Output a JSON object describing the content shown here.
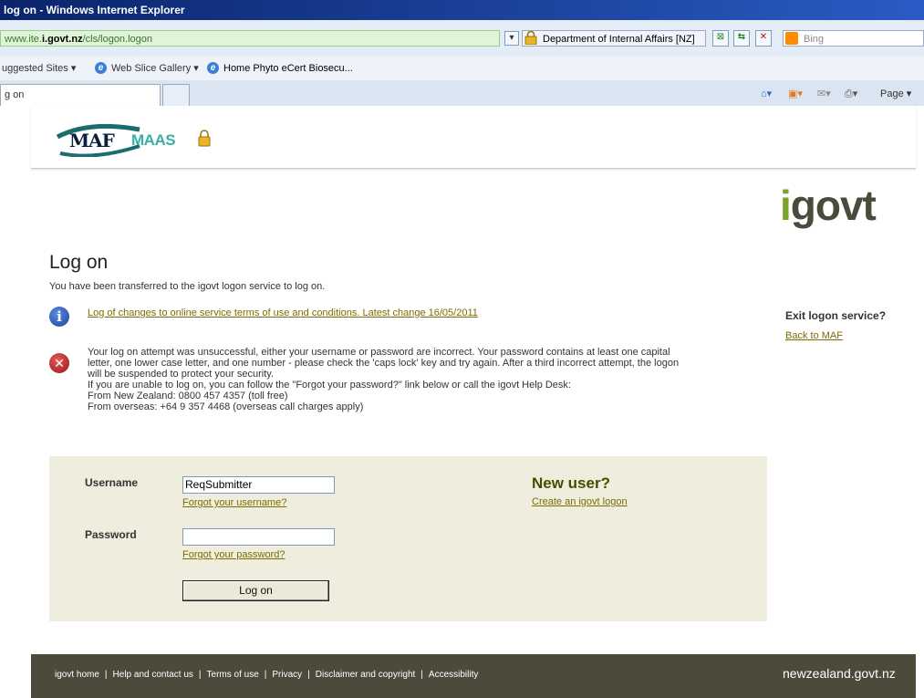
{
  "window": {
    "title": "log on - Windows Internet Explorer"
  },
  "addressbar": {
    "url_prefix": "www.ite.",
    "url_domain": "i.govt.nz",
    "url_path": "/cls/logon.logon",
    "cert_label": "Department of Internal Affairs [NZ]",
    "search_placeholder": "Bing"
  },
  "favorites": {
    "items": [
      "uggested Sites ▾",
      "Web Slice Gallery ▾",
      "Home Phyto eCert Biosecu..."
    ]
  },
  "tabs": {
    "active_label": "g on"
  },
  "commandbar": {
    "page_label": "Page ▾"
  },
  "header": {
    "brand_left": "MAF",
    "brand_right": "MAAS",
    "igovt_i": "i",
    "igovt_rest": "govt"
  },
  "main": {
    "title": "Log on",
    "transfer_text": "You have been transferred to the igovt logon service to log on.",
    "changelog_link": "Log of changes to online service terms of use and conditions. Latest change 16/05/2011",
    "error_lines": [
      "Your log on attempt was unsuccessful, either your username or password are incorrect. Your password contains at least one capital",
      "letter, one lower case letter, and one number - please check the 'caps lock' key and try again. After a third incorrect attempt, the logon",
      "will be suspended to protect your security.",
      "If you are unable to log on, you can follow the \"Forgot your password?\" link below or call the igovt Help Desk:",
      "From New Zealand: 0800 457 4357 (toll free)",
      "From overseas: +64 9 357 4468 (overseas call charges apply)"
    ]
  },
  "sidebar": {
    "exit_label": "Exit logon service?",
    "back_link": "Back to MAF"
  },
  "login": {
    "username_label": "Username",
    "username_value": "ReqSubmitter",
    "forgot_username": "Forgot your username?",
    "password_label": "Password",
    "password_value": "",
    "forgot_password": "Forgot your password?",
    "logon_button": "Log on",
    "new_user_heading": "New user?",
    "create_link": "Create an igovt logon"
  },
  "footer": {
    "links": [
      "igovt home",
      "Help and contact us",
      "Terms of use",
      "Privacy",
      "Disclaimer and copyright",
      "Accessibility"
    ],
    "nz_brand": "newzealand.govt.nz"
  }
}
